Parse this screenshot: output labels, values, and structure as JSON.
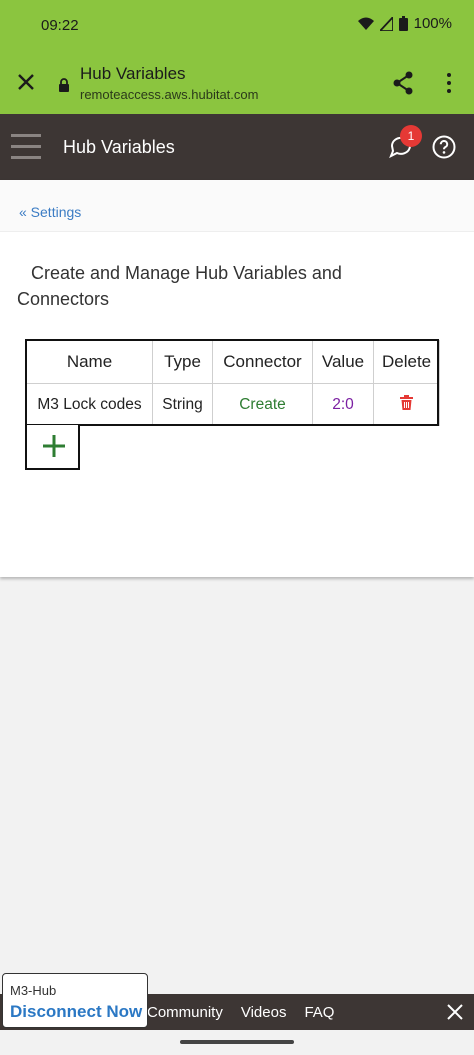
{
  "status": {
    "time": "09:22",
    "battery": "100%"
  },
  "tab": {
    "title": "Hub Variables",
    "url": "remoteaccess.aws.hubitat.com"
  },
  "header": {
    "title": "Hub Variables",
    "notifications": "1"
  },
  "breadcrumb": "« Settings",
  "page": {
    "heading": "Create and Manage Hub Variables and Connectors"
  },
  "table": {
    "headers": [
      "Name",
      "Type",
      "Connector",
      "Value",
      "Delete"
    ],
    "rows": [
      {
        "name": "M3 Lock codes",
        "type": "String",
        "connector": "Create",
        "value": "2:0"
      }
    ]
  },
  "footer": {
    "links": [
      "Community",
      "Videos",
      "FAQ"
    ]
  },
  "hub": {
    "name": "M3-Hub",
    "action": "Disconnect Now"
  },
  "colors": {
    "brand_green": "#8bc53f",
    "header_dark": "#3d3634",
    "link_blue": "#3b7cc4"
  }
}
